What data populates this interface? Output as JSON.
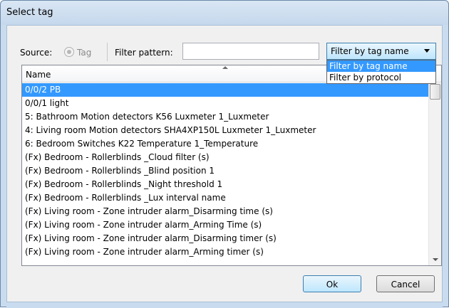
{
  "window": {
    "title": "Select tag"
  },
  "source": {
    "label": "Source:",
    "radio_label": "Tag"
  },
  "filter": {
    "label": "Filter pattern:",
    "value": "",
    "mode_selected": "Filter by tag name",
    "options": [
      "Filter by tag name",
      "Filter by protocol"
    ]
  },
  "list": {
    "column_header": "Name",
    "rows": [
      "0/0/2 PB",
      "0/0/1 light",
      "5: Bathroom Motion detectors K56 Luxmeter 1_Luxmeter",
      "4: Living room Motion detectors SHA4XP150L Luxmeter 1_Luxmeter",
      "6: Bedroom Switches K22 Temperature 1_Temperature",
      "(Fx) Bedroom - Rollerblinds _Cloud filter (s)",
      "(Fx) Bedroom - Rollerblinds _Blind position 1",
      "(Fx) Bedroom - Rollerblinds _Night threshold 1",
      "(Fx) Bedroom - Rollerblinds _Lux interval name",
      "(Fx) Living room - Zone intruder alarm_Disarming time (s)",
      "(Fx) Living room - Zone intruder alarm_Arming Time (s)",
      "(Fx) Living room - Zone intruder alarm_Disarming timer (s)",
      "(Fx) Living room - Zone intruder alarm_Arming timer (s)"
    ],
    "selected_index": 0
  },
  "buttons": {
    "ok": "Ok",
    "cancel": "Cancel"
  }
}
